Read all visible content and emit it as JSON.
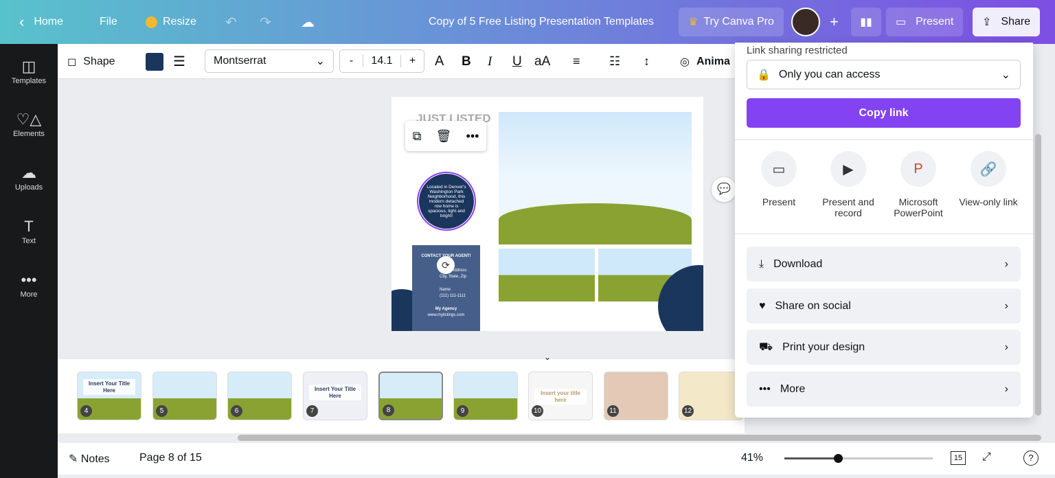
{
  "topbar": {
    "home": "Home",
    "file": "File",
    "resize": "Resize",
    "title": "Copy of 5 Free Listing Presentation Templates",
    "try_pro": "Try Canva Pro",
    "present": "Present",
    "share": "Share"
  },
  "sidebar": {
    "items": [
      {
        "label": "Templates",
        "icon": "templates-icon"
      },
      {
        "label": "Elements",
        "icon": "elements-icon"
      },
      {
        "label": "Uploads",
        "icon": "uploads-icon"
      },
      {
        "label": "Text",
        "icon": "text-icon"
      },
      {
        "label": "More",
        "icon": "more-icon"
      }
    ]
  },
  "toolbar": {
    "shape": "Shape",
    "color": "#1b365d",
    "font": "Montserrat",
    "font_size": "14.1",
    "minus": "-",
    "plus": "+",
    "bold": "B",
    "italic": "I",
    "underline": "U",
    "case": "aA",
    "animate": "Anima"
  },
  "page": {
    "heading": "JUST LISTED",
    "circle_text": "Located in Denver's Washington Park Neighborhood, this modern detached row home is spacious, light and bright!",
    "contact_title": "CONTACT YOUR AGENT!",
    "address1": "Street Address",
    "address2": "City, State, Zip",
    "name": "Name",
    "phone": "(111) 111-1111",
    "agency": "My Agency",
    "website": "www.mylistings.com"
  },
  "thumbnails": [
    {
      "n": "4",
      "title": "Insert Your Title Here"
    },
    {
      "n": "5"
    },
    {
      "n": "6"
    },
    {
      "n": "7",
      "title": "Insert Your Title Here"
    },
    {
      "n": "8",
      "selected": true
    },
    {
      "n": "9"
    },
    {
      "n": "10",
      "title": "Insert your title here"
    },
    {
      "n": "11"
    },
    {
      "n": "12"
    }
  ],
  "bottom": {
    "notes": "Notes",
    "page": "Page 8 of 15",
    "zoom": "41%",
    "zoom_level_percent": 41,
    "pages_count": "15"
  },
  "share": {
    "restricted": "Link sharing restricted",
    "access": "Only you can access",
    "copy_link": "Copy link",
    "options": [
      {
        "label": "Present"
      },
      {
        "label": "Present and record"
      },
      {
        "label": "Microsoft PowerPoint"
      },
      {
        "label": "View-only link"
      }
    ],
    "rows": [
      {
        "label": "Download"
      },
      {
        "label": "Share on social"
      },
      {
        "label": "Print your design"
      },
      {
        "label": "More"
      }
    ],
    "accent": "#8343f2"
  }
}
